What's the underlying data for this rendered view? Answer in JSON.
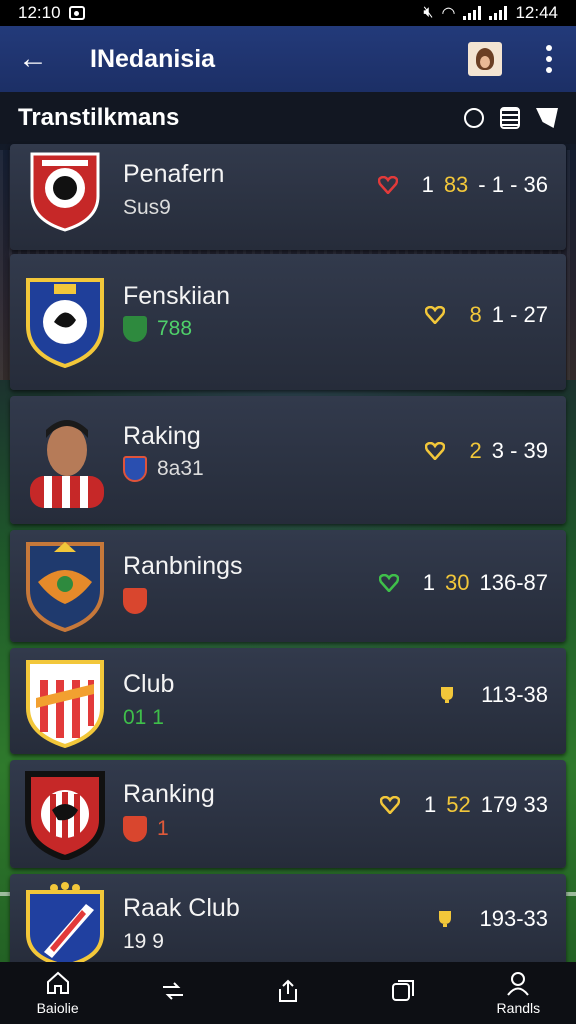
{
  "status_bar": {
    "time_left": "12:10",
    "time_right": "12:44"
  },
  "app_bar": {
    "title": "INedanisia"
  },
  "section": {
    "title": "Transtilkmans"
  },
  "rows": [
    {
      "name": "Penafern",
      "sub": "Sus9",
      "stat_a": "1",
      "stat_b": "83",
      "stat_c": "- 1  - 36",
      "heart_color": "#e23a3a"
    },
    {
      "name": "Fenskiian",
      "sub": "788",
      "stat_a": "",
      "stat_b": "8",
      "stat_c": "1 - 27",
      "heart_color": "#f2c73a"
    },
    {
      "name": "Raking",
      "sub": "8a31",
      "stat_a": "",
      "stat_b": "2",
      "stat_c": "3 - 39",
      "heart_color": "#f2c73a"
    },
    {
      "name": "Ranbnings",
      "sub": "",
      "stat_a": "1",
      "stat_b": "30",
      "stat_c": "136-87",
      "heart_color": "#3fbf4a"
    },
    {
      "name": "Club",
      "sub": "01  1",
      "stat_a": "",
      "stat_b": "",
      "stat_c": "113-38",
      "heart_color": "#f2c73a"
    },
    {
      "name": "Ranking",
      "sub": "1",
      "stat_a": "1",
      "stat_b": "52",
      "stat_c": "179  33",
      "heart_color": "#f2c73a"
    },
    {
      "name": "Raak Club",
      "sub": "19  9",
      "stat_a": "",
      "stat_b": "",
      "stat_c": "193-33",
      "heart_color": "#f2c73a"
    }
  ],
  "bottom_nav": [
    {
      "label": "Baiolie",
      "icon": "home-icon"
    },
    {
      "label": "",
      "icon": "transfer-icon"
    },
    {
      "label": "",
      "icon": "share-icon"
    },
    {
      "label": "",
      "icon": "cards-icon"
    },
    {
      "label": "Randls",
      "icon": "profile-icon"
    }
  ]
}
